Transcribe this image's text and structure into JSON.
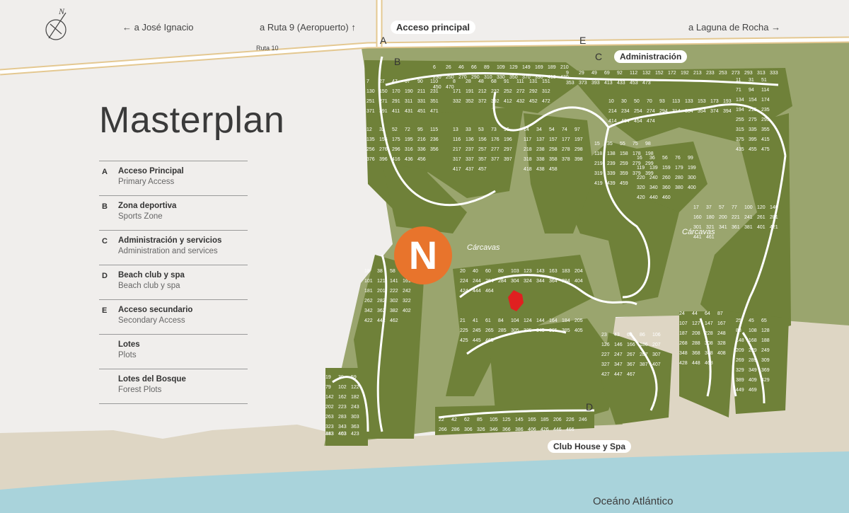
{
  "map": {
    "title": "Masterplan",
    "nav": {
      "west": "← a José Ignacio",
      "airport": "a Ruta 9 (Aeropuerto) ↑",
      "east": "a Laguna de Rocha →"
    },
    "road_label": "Ruta 10",
    "compass_label": "N",
    "labels": {
      "acceso_principal": "Acceso principal",
      "administracion": "Administración",
      "club_house": "Club House y Spa",
      "ocean": "Oceáno Atlántico",
      "carcavas_left": "Cárcavas",
      "carcavas_right": "Cárcavas"
    },
    "map_letters": [
      "A",
      "B",
      "C",
      "D",
      "E"
    ],
    "legend": [
      {
        "letter": "A",
        "title": "Acceso Principal",
        "subtitle": "Primary Access"
      },
      {
        "letter": "B",
        "title": "Zona deportiva",
        "subtitle": "Sports Zone"
      },
      {
        "letter": "C",
        "title": "Administración y servicios",
        "subtitle": "Administration and services"
      },
      {
        "letter": "D",
        "title": "Beach club y spa",
        "subtitle": "Beach club y spa"
      },
      {
        "letter": "E",
        "title": "Acceso secundario",
        "subtitle": "Secondary Access"
      },
      {
        "letter": "",
        "title": "Lotes",
        "subtitle": "Plots"
      },
      {
        "letter": "",
        "title": "Lotes del Bosque",
        "subtitle": "Forest Plots"
      }
    ],
    "brand_letter": "N",
    "colors": {
      "background": "#f0eeec",
      "land": "#9aa56e",
      "plots": "#6f8139",
      "roads": "#ffffff",
      "sand": "#ded6c4",
      "ocean": "#a9d3db",
      "brand": "#e8742c",
      "marker": "#e02020",
      "highway": "#e4c891"
    },
    "plots": [
      {
        "n": "6"
      },
      {
        "n": "7"
      },
      {
        "n": "8"
      },
      {
        "n": "9"
      },
      {
        "n": "10"
      },
      {
        "n": "11"
      },
      {
        "n": "12"
      },
      {
        "n": "13"
      },
      {
        "n": "14"
      },
      {
        "n": "15"
      },
      {
        "n": "16"
      },
      {
        "n": "17"
      },
      {
        "n": "18"
      },
      {
        "n": "19"
      },
      {
        "n": "20"
      },
      {
        "n": "21"
      },
      {
        "n": "22"
      },
      {
        "n": "23"
      },
      {
        "n": "24"
      },
      {
        "n": "25"
      },
      {
        "n": "26"
      },
      {
        "n": "27"
      },
      {
        "n": "28"
      },
      {
        "n": "29"
      },
      {
        "n": "30"
      },
      {
        "n": "31"
      },
      {
        "n": "32"
      },
      {
        "n": "33"
      },
      {
        "n": "34"
      },
      {
        "n": "35"
      },
      {
        "n": "36"
      },
      {
        "n": "37"
      },
      {
        "n": "38"
      },
      {
        "n": "39"
      },
      {
        "n": "40"
      },
      {
        "n": "41"
      },
      {
        "n": "42"
      },
      {
        "n": "43"
      },
      {
        "n": "44"
      },
      {
        "n": "45"
      },
      {
        "n": "46"
      },
      {
        "n": "47"
      },
      {
        "n": "48"
      },
      {
        "n": "49"
      },
      {
        "n": "50"
      },
      {
        "n": "51"
      },
      {
        "n": "52"
      },
      {
        "n": "53"
      },
      {
        "n": "54"
      },
      {
        "n": "55"
      },
      {
        "n": "56"
      },
      {
        "n": "57"
      },
      {
        "n": "58"
      },
      {
        "n": "59"
      },
      {
        "n": "60"
      },
      {
        "n": "61"
      },
      {
        "n": "62"
      },
      {
        "n": "63"
      },
      {
        "n": "64"
      },
      {
        "n": "65"
      },
      {
        "n": "66"
      },
      {
        "n": "67"
      },
      {
        "n": "68"
      },
      {
        "n": "69"
      },
      {
        "n": "70"
      },
      {
        "n": "71"
      },
      {
        "n": "72"
      },
      {
        "n": "73"
      },
      {
        "n": "74"
      },
      {
        "n": "75"
      },
      {
        "n": "76"
      },
      {
        "n": "77"
      },
      {
        "n": "78"
      },
      {
        "n": "79"
      },
      {
        "n": "80"
      },
      {
        "n": "84"
      },
      {
        "n": "85"
      },
      {
        "n": "86"
      },
      {
        "n": "87"
      },
      {
        "n": "88"
      },
      {
        "n": "89"
      },
      {
        "n": "90"
      },
      {
        "n": "91"
      },
      {
        "n": "92"
      },
      {
        "n": "93"
      },
      {
        "n": "94"
      },
      {
        "n": "95"
      },
      {
        "n": "96"
      },
      {
        "n": "97"
      },
      {
        "n": "98"
      },
      {
        "n": "99"
      },
      {
        "n": "100"
      },
      {
        "n": "101"
      },
      {
        "n": "102"
      },
      {
        "n": "103"
      },
      {
        "n": "104"
      },
      {
        "n": "105"
      },
      {
        "n": "106"
      },
      {
        "n": "107"
      },
      {
        "n": "108"
      },
      {
        "n": "109"
      },
      {
        "n": "110"
      },
      {
        "n": "111"
      },
      {
        "n": "112"
      },
      {
        "n": "113"
      },
      {
        "n": "114"
      },
      {
        "n": "115"
      },
      {
        "n": "116"
      },
      {
        "n": "117"
      },
      {
        "n": "118"
      },
      {
        "n": "119"
      },
      {
        "n": "120"
      },
      {
        "n": "121"
      },
      {
        "n": "122"
      },
      {
        "n": "123"
      },
      {
        "n": "124"
      },
      {
        "n": "125"
      },
      {
        "n": "126"
      },
      {
        "n": "127"
      },
      {
        "n": "128"
      },
      {
        "n": "129"
      },
      {
        "n": "130"
      },
      {
        "n": "131"
      },
      {
        "n": "132"
      },
      {
        "n": "133"
      },
      {
        "n": "134"
      },
      {
        "n": "135"
      },
      {
        "n": "136"
      },
      {
        "n": "137"
      },
      {
        "n": "138"
      },
      {
        "n": "139"
      },
      {
        "n": "140"
      },
      {
        "n": "141"
      },
      {
        "n": "142"
      },
      {
        "n": "143"
      },
      {
        "n": "144"
      },
      {
        "n": "145"
      },
      {
        "n": "146"
      },
      {
        "n": "147"
      },
      {
        "n": "148"
      },
      {
        "n": "149"
      },
      {
        "n": "150"
      },
      {
        "n": "151"
      },
      {
        "n": "152"
      },
      {
        "n": "153"
      },
      {
        "n": "154"
      },
      {
        "n": "155"
      },
      {
        "n": "156"
      },
      {
        "n": "157"
      },
      {
        "n": "158"
      },
      {
        "n": "159"
      },
      {
        "n": "160"
      },
      {
        "n": "161"
      },
      {
        "n": "162"
      },
      {
        "n": "163"
      },
      {
        "n": "164"
      },
      {
        "n": "165"
      },
      {
        "n": "166"
      },
      {
        "n": "167"
      },
      {
        "n": "168"
      },
      {
        "n": "169"
      },
      {
        "n": "170"
      },
      {
        "n": "171"
      },
      {
        "n": "172"
      },
      {
        "n": "173"
      },
      {
        "n": "174"
      },
      {
        "n": "175"
      },
      {
        "n": "176"
      },
      {
        "n": "177"
      },
      {
        "n": "178"
      },
      {
        "n": "179"
      },
      {
        "n": "180"
      },
      {
        "n": "181"
      },
      {
        "n": "182"
      },
      {
        "n": "183"
      },
      {
        "n": "184"
      },
      {
        "n": "185"
      },
      {
        "n": "186"
      },
      {
        "n": "187"
      },
      {
        "n": "188"
      },
      {
        "n": "189"
      },
      {
        "n": "190"
      },
      {
        "n": "191"
      },
      {
        "n": "192"
      },
      {
        "n": "193"
      },
      {
        "n": "194"
      },
      {
        "n": "195"
      },
      {
        "n": "196"
      },
      {
        "n": "197"
      },
      {
        "n": "198"
      },
      {
        "n": "199"
      },
      {
        "n": "200"
      },
      {
        "n": "201"
      },
      {
        "n": "202"
      },
      {
        "n": "204"
      },
      {
        "n": "205"
      },
      {
        "n": "206"
      },
      {
        "n": "207"
      },
      {
        "n": "208"
      },
      {
        "n": "209"
      },
      {
        "n": "210"
      },
      {
        "n": "211"
      },
      {
        "n": "212"
      },
      {
        "n": "213"
      },
      {
        "n": "214"
      },
      {
        "n": "215"
      },
      {
        "n": "216"
      },
      {
        "n": "217"
      },
      {
        "n": "218"
      },
      {
        "n": "219"
      },
      {
        "n": "220"
      },
      {
        "n": "221"
      },
      {
        "n": "222"
      },
      {
        "n": "223"
      },
      {
        "n": "224"
      },
      {
        "n": "225"
      },
      {
        "n": "226"
      },
      {
        "n": "227"
      },
      {
        "n": "228"
      },
      {
        "n": "229"
      },
      {
        "n": "230"
      },
      {
        "n": "231"
      },
      {
        "n": "232"
      },
      {
        "n": "233"
      },
      {
        "n": "234"
      },
      {
        "n": "235"
      },
      {
        "n": "236"
      },
      {
        "n": "237"
      },
      {
        "n": "238"
      },
      {
        "n": "239"
      },
      {
        "n": "240"
      },
      {
        "n": "241"
      },
      {
        "n": "242"
      },
      {
        "n": "243"
      },
      {
        "n": "244"
      },
      {
        "n": "245"
      },
      {
        "n": "246"
      },
      {
        "n": "247"
      },
      {
        "n": "248"
      },
      {
        "n": "249"
      },
      {
        "n": "250"
      },
      {
        "n": "251"
      },
      {
        "n": "252"
      },
      {
        "n": "253"
      },
      {
        "n": "254"
      },
      {
        "n": "255"
      },
      {
        "n": "256"
      },
      {
        "n": "257"
      },
      {
        "n": "258"
      },
      {
        "n": "259"
      },
      {
        "n": "260"
      },
      {
        "n": "261"
      },
      {
        "n": "262"
      },
      {
        "n": "263"
      },
      {
        "n": "264"
      },
      {
        "n": "265"
      },
      {
        "n": "266"
      },
      {
        "n": "267"
      },
      {
        "n": "268"
      },
      {
        "n": "269"
      },
      {
        "n": "270"
      },
      {
        "n": "271"
      },
      {
        "n": "272"
      },
      {
        "n": "273"
      },
      {
        "n": "274"
      },
      {
        "n": "275"
      },
      {
        "n": "276"
      },
      {
        "n": "277"
      },
      {
        "n": "278"
      },
      {
        "n": "279"
      },
      {
        "n": "280"
      },
      {
        "n": "281"
      },
      {
        "n": "282"
      },
      {
        "n": "283"
      },
      {
        "n": "284"
      },
      {
        "n": "285"
      },
      {
        "n": "286"
      },
      {
        "n": "287"
      },
      {
        "n": "288"
      },
      {
        "n": "289"
      },
      {
        "n": "290"
      },
      {
        "n": "291"
      },
      {
        "n": "292"
      },
      {
        "n": "293"
      },
      {
        "n": "294"
      },
      {
        "n": "295"
      },
      {
        "n": "296"
      },
      {
        "n": "297"
      },
      {
        "n": "298"
      },
      {
        "n": "299"
      },
      {
        "n": "300"
      },
      {
        "n": "301"
      },
      {
        "n": "302"
      },
      {
        "n": "303"
      },
      {
        "n": "304"
      },
      {
        "n": "305"
      },
      {
        "n": "306"
      },
      {
        "n": "307"
      },
      {
        "n": "308"
      },
      {
        "n": "309"
      },
      {
        "n": "310"
      },
      {
        "n": "311"
      },
      {
        "n": "312"
      },
      {
        "n": "313"
      },
      {
        "n": "314"
      },
      {
        "n": "315"
      },
      {
        "n": "316"
      },
      {
        "n": "317"
      },
      {
        "n": "318"
      },
      {
        "n": "319"
      },
      {
        "n": "320"
      },
      {
        "n": "321"
      },
      {
        "n": "322"
      },
      {
        "n": "323"
      },
      {
        "n": "324"
      },
      {
        "n": "325"
      },
      {
        "n": "326"
      },
      {
        "n": "327"
      },
      {
        "n": "328"
      },
      {
        "n": "329"
      },
      {
        "n": "330"
      },
      {
        "n": "331"
      },
      {
        "n": "332"
      },
      {
        "n": "333"
      },
      {
        "n": "334"
      },
      {
        "n": "335"
      },
      {
        "n": "336"
      },
      {
        "n": "337"
      },
      {
        "n": "338"
      },
      {
        "n": "339"
      },
      {
        "n": "340"
      },
      {
        "n": "341"
      },
      {
        "n": "342"
      },
      {
        "n": "343"
      },
      {
        "n": "344"
      },
      {
        "n": "345"
      },
      {
        "n": "346"
      },
      {
        "n": "347"
      },
      {
        "n": "348"
      },
      {
        "n": "349"
      },
      {
        "n": "350"
      },
      {
        "n": "351"
      },
      {
        "n": "352"
      },
      {
        "n": "353"
      },
      {
        "n": "354"
      },
      {
        "n": "355"
      },
      {
        "n": "356"
      },
      {
        "n": "357"
      },
      {
        "n": "358"
      },
      {
        "n": "359"
      },
      {
        "n": "360"
      },
      {
        "n": "361"
      },
      {
        "n": "362"
      },
      {
        "n": "363"
      },
      {
        "n": "364"
      },
      {
        "n": "365"
      },
      {
        "n": "366"
      },
      {
        "n": "367"
      },
      {
        "n": "368"
      },
      {
        "n": "369"
      },
      {
        "n": "370"
      },
      {
        "n": "371"
      },
      {
        "n": "372"
      },
      {
        "n": "373"
      },
      {
        "n": "374"
      },
      {
        "n": "375"
      },
      {
        "n": "376"
      },
      {
        "n": "377"
      },
      {
        "n": "378"
      },
      {
        "n": "379"
      },
      {
        "n": "380"
      },
      {
        "n": "381"
      },
      {
        "n": "382"
      },
      {
        "n": "383"
      },
      {
        "n": "384"
      },
      {
        "n": "385"
      },
      {
        "n": "386"
      },
      {
        "n": "387"
      },
      {
        "n": "388"
      },
      {
        "n": "389"
      },
      {
        "n": "390"
      },
      {
        "n": "391"
      },
      {
        "n": "392"
      },
      {
        "n": "393"
      },
      {
        "n": "394"
      },
      {
        "n": "395"
      },
      {
        "n": "396"
      },
      {
        "n": "397"
      },
      {
        "n": "398"
      },
      {
        "n": "399"
      },
      {
        "n": "400"
      },
      {
        "n": "401"
      },
      {
        "n": "402"
      },
      {
        "n": "403"
      },
      {
        "n": "404"
      },
      {
        "n": "405"
      },
      {
        "n": "406"
      },
      {
        "n": "407"
      },
      {
        "n": "408"
      },
      {
        "n": "409"
      },
      {
        "n": "410"
      },
      {
        "n": "411"
      },
      {
        "n": "412"
      },
      {
        "n": "413"
      },
      {
        "n": "414"
      },
      {
        "n": "415"
      },
      {
        "n": "416"
      },
      {
        "n": "417"
      },
      {
        "n": "418"
      },
      {
        "n": "419"
      },
      {
        "n": "420"
      },
      {
        "n": "421"
      },
      {
        "n": "422"
      },
      {
        "n": "423"
      },
      {
        "n": "424"
      },
      {
        "n": "425"
      },
      {
        "n": "426"
      },
      {
        "n": "427"
      },
      {
        "n": "428"
      },
      {
        "n": "429"
      },
      {
        "n": "430"
      },
      {
        "n": "431"
      },
      {
        "n": "432"
      },
      {
        "n": "433"
      },
      {
        "n": "434"
      },
      {
        "n": "435"
      },
      {
        "n": "436"
      },
      {
        "n": "437"
      },
      {
        "n": "438"
      },
      {
        "n": "439"
      },
      {
        "n": "440"
      },
      {
        "n": "441"
      },
      {
        "n": "442"
      },
      {
        "n": "443"
      },
      {
        "n": "444"
      },
      {
        "n": "445"
      },
      {
        "n": "446"
      },
      {
        "n": "447"
      },
      {
        "n": "448"
      },
      {
        "n": "449"
      },
      {
        "n": "450"
      },
      {
        "n": "451"
      },
      {
        "n": "452"
      },
      {
        "n": "453"
      },
      {
        "n": "454"
      },
      {
        "n": "455"
      },
      {
        "n": "456"
      },
      {
        "n": "457"
      },
      {
        "n": "458"
      },
      {
        "n": "459"
      },
      {
        "n": "460"
      },
      {
        "n": "461"
      },
      {
        "n": "462"
      },
      {
        "n": "463"
      },
      {
        "n": "464"
      },
      {
        "n": "465"
      },
      {
        "n": "466"
      },
      {
        "n": "467"
      },
      {
        "n": "468"
      },
      {
        "n": "469"
      },
      {
        "n": "470"
      },
      {
        "n": "471"
      },
      {
        "n": "472"
      },
      {
        "n": "473"
      },
      {
        "n": "474"
      },
      {
        "n": "475"
      }
    ]
  }
}
